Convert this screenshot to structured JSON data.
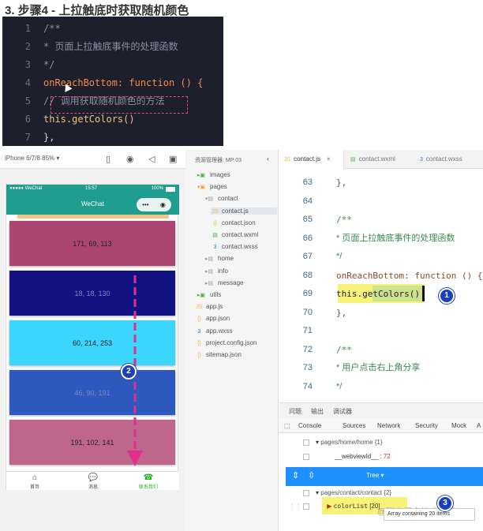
{
  "heading": "3. 步骤4 - 上拉触底时获取随机颜色",
  "top_code": [
    {
      "num": "1",
      "text": "/**",
      "color": "#8a8fa3"
    },
    {
      "num": "2",
      "text": " * 页面上拉触底事件的处理函数",
      "color": "#8a8fa3"
    },
    {
      "num": "3",
      "text": " */",
      "color": "#8a8fa3"
    },
    {
      "num": "4",
      "text": "onReachBottom: function () {",
      "color": "#f28b4a"
    },
    {
      "num": "5",
      "text": "  // 调用获取随机颜色的方法",
      "color": "#8a8fa3"
    },
    {
      "num": "6",
      "text": "  this.getColors()",
      "color": "#f2c27a"
    },
    {
      "num": "7",
      "text": "},",
      "color": "#d0d3e0"
    }
  ],
  "simulator": {
    "device": "iPhone 6/7/8 85% ▾",
    "carrier": "●●●●● WeChat",
    "time": "15:57",
    "battery": "100%",
    "title": "WeChat",
    "capsule_dots": "•••",
    "capsule_circle": "◉",
    "blocks": [
      {
        "label": "171, 69, 113",
        "color": "#ab4571"
      },
      {
        "label": "18, 18, 130",
        "color": "#121282"
      },
      {
        "label": "60, 214, 253",
        "color": "#3cd6fd"
      },
      {
        "label": "46, 90, 191",
        "color": "#2e5abf"
      },
      {
        "label": "191, 102, 141",
        "color": "#bf668d"
      }
    ],
    "tabs": [
      "首页",
      "消息",
      "联系我们"
    ]
  },
  "explorer": {
    "header": "资源管理器: MP 03",
    "items": [
      {
        "label": "images",
        "indent": 0,
        "icon": "▸▣",
        "iconColor": "#4caf50"
      },
      {
        "label": "pages",
        "indent": 0,
        "icon": "▾▣",
        "iconColor": "#f0a23c"
      },
      {
        "label": "contact",
        "indent": 1,
        "icon": "▾▤",
        "iconColor": "#999"
      },
      {
        "label": "contact.js",
        "indent": 2,
        "icon": "JS",
        "iconColor": "#e8c13a",
        "selected": true
      },
      {
        "label": "contact.json",
        "indent": 2,
        "icon": "{}",
        "iconColor": "#e8c13a"
      },
      {
        "label": "contact.wxml",
        "indent": 2,
        "icon": "▤",
        "iconColor": "#4caf50"
      },
      {
        "label": "contact.wxss",
        "indent": 2,
        "icon": "3",
        "iconColor": "#2f7bd9"
      },
      {
        "label": "home",
        "indent": 1,
        "icon": "▸▤",
        "iconColor": "#999"
      },
      {
        "label": "info",
        "indent": 1,
        "icon": "▸▤",
        "iconColor": "#999"
      },
      {
        "label": "message",
        "indent": 1,
        "icon": "▸▤",
        "iconColor": "#999"
      },
      {
        "label": "utils",
        "indent": 0,
        "icon": "▸▣",
        "iconColor": "#4caf50"
      },
      {
        "label": "app.js",
        "indent": 0,
        "icon": "JS",
        "iconColor": "#e8c13a"
      },
      {
        "label": "app.json",
        "indent": 0,
        "icon": "{}",
        "iconColor": "#e8c13a"
      },
      {
        "label": "app.wxss",
        "indent": 0,
        "icon": "3",
        "iconColor": "#2f7bd9"
      },
      {
        "label": "project.config.json",
        "indent": 0,
        "icon": "{}",
        "iconColor": "#e8c13a"
      },
      {
        "label": "sitemap.json",
        "indent": 0,
        "icon": "{}",
        "iconColor": "#e8c13a"
      }
    ]
  },
  "editor_tabs": [
    {
      "label": "contact.js",
      "close": "×",
      "icon": "JS",
      "iconColor": "#e8c13a",
      "active": true
    },
    {
      "label": "contact.wxml",
      "icon": "▤",
      "iconColor": "#4caf50"
    },
    {
      "label": "contact.wxss",
      "icon": "3",
      "iconColor": "#2f7bd9"
    }
  ],
  "editor_lines": [
    {
      "num": "63",
      "text": "},",
      "color": "#555"
    },
    {
      "num": "64",
      "text": "",
      "color": "#555"
    },
    {
      "num": "65",
      "text": "/**",
      "color": "#3b8a4f"
    },
    {
      "num": "66",
      "text": " * 页面上拉触底事件的处理函数",
      "color": "#3b8a4f"
    },
    {
      "num": "67",
      "text": " */",
      "color": "#3b8a4f"
    },
    {
      "num": "68",
      "text": "onReachBottom: function () {",
      "color": "#8a4a2a"
    },
    {
      "num": "69",
      "text": "  this.getColors()",
      "color": "#222"
    },
    {
      "num": "70",
      "text": "},",
      "color": "#555"
    },
    {
      "num": "71",
      "text": "",
      "color": "#555"
    },
    {
      "num": "72",
      "text": "/**",
      "color": "#3b8a4f"
    },
    {
      "num": "73",
      "text": " * 用户点击右上角分享",
      "color": "#3b8a4f"
    },
    {
      "num": "74",
      "text": " */",
      "color": "#3b8a4f"
    }
  ],
  "devtools": {
    "top_tabs": [
      "问题",
      "输出",
      "调试器"
    ],
    "panel_tabs": [
      "Console",
      "Sources",
      "Network",
      "Security",
      "Mock",
      "A"
    ],
    "row1": "pages/home/home {1}",
    "row2_key": "__webviewId__",
    "row2_val": "72",
    "tree_label": "Tree ▾",
    "row3": "pages/contact/contact {2}",
    "row4_key": "colorList",
    "row4_val": "[20]",
    "tooltip": "Array containing 20 items"
  },
  "badges": [
    "1",
    "2",
    "3"
  ],
  "watermark": "@稀土掘金技术社区"
}
